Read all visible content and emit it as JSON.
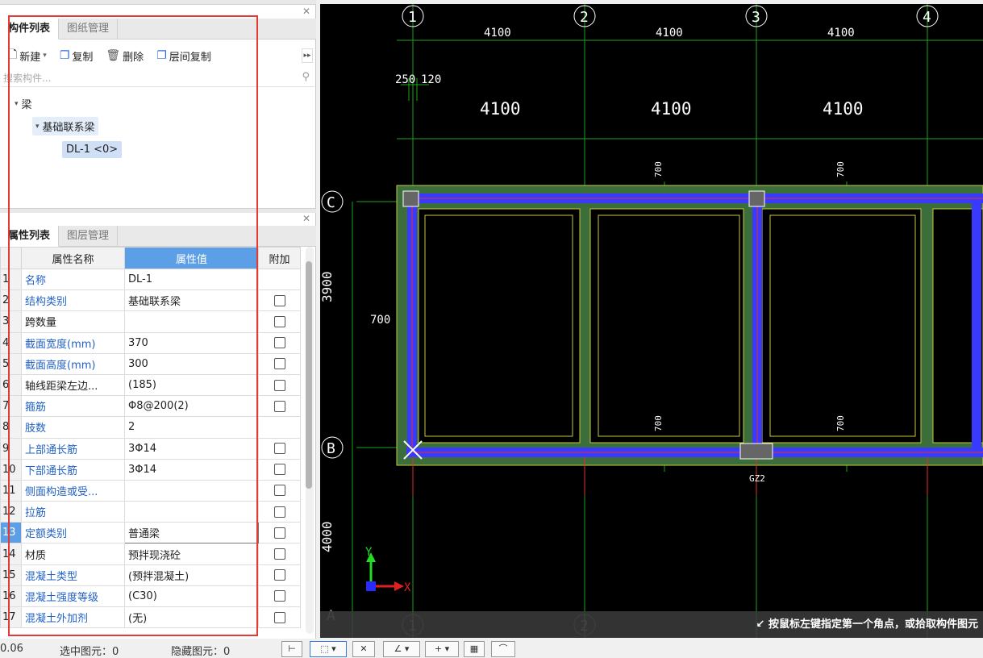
{
  "component_panel": {
    "tabs": [
      "构件列表",
      "图纸管理"
    ],
    "toolbar": {
      "new": "新建",
      "copy": "复制",
      "delete": "删除",
      "floor_copy": "层间复制"
    },
    "search_placeholder": "搜索构件...",
    "tree": {
      "root": "梁",
      "child": "基础联系梁",
      "leaf": "DL-1 <0>"
    }
  },
  "property_panel": {
    "tabs": [
      "属性列表",
      "图层管理"
    ],
    "headers": {
      "name": "属性名称",
      "value": "属性值",
      "extra": "附加"
    },
    "rows": [
      {
        "num": "1",
        "name": "名称",
        "value": "DL-1"
      },
      {
        "num": "2",
        "name": "结构类别",
        "value": "基础联系梁"
      },
      {
        "num": "3",
        "name": "跨数量",
        "value": ""
      },
      {
        "num": "4",
        "name": "截面宽度(mm)",
        "value": "370"
      },
      {
        "num": "5",
        "name": "截面高度(mm)",
        "value": "300"
      },
      {
        "num": "6",
        "name": "轴线距梁左边...",
        "value": "(185)"
      },
      {
        "num": "7",
        "name": "箍筋",
        "value": "Φ8@200(2)"
      },
      {
        "num": "8",
        "name": "肢数",
        "value": "2"
      },
      {
        "num": "9",
        "name": "上部通长筋",
        "value": "3Φ14"
      },
      {
        "num": "10",
        "name": "下部通长筋",
        "value": "3Φ14"
      },
      {
        "num": "11",
        "name": "侧面构造或受...",
        "value": ""
      },
      {
        "num": "12",
        "name": "拉筋",
        "value": ""
      },
      {
        "num": "13",
        "name": "定额类别",
        "value": "普通梁"
      },
      {
        "num": "14",
        "name": "材质",
        "value": "预拌现浇砼"
      },
      {
        "num": "15",
        "name": "混凝土类型",
        "value": "(预拌混凝土)"
      },
      {
        "num": "16",
        "name": "混凝土强度等级",
        "value": "(C30)"
      },
      {
        "num": "17",
        "name": "混凝土外加剂",
        "value": "(无)"
      }
    ]
  },
  "drawing": {
    "axes_top": [
      "1",
      "2",
      "3",
      "4"
    ],
    "axes_left": [
      "C",
      "B",
      "A"
    ],
    "dim_small": "4100",
    "dim_large": "4100",
    "dim_250": "250",
    "dim_120": "120",
    "dim_700": "700",
    "left_dim_1": "3900",
    "left_dim_2": "4000",
    "gz_label": "GZ2",
    "ucs_x": "X",
    "ucs_y": "Y",
    "beam_color": "#3a3aff",
    "hint": "按鼠标左键指定第一个角点，或拾取构件图元"
  },
  "statusbar": {
    "coord": "0.06",
    "selected_label": "选中图元：0",
    "hidden_label": "隐藏图元：0"
  }
}
